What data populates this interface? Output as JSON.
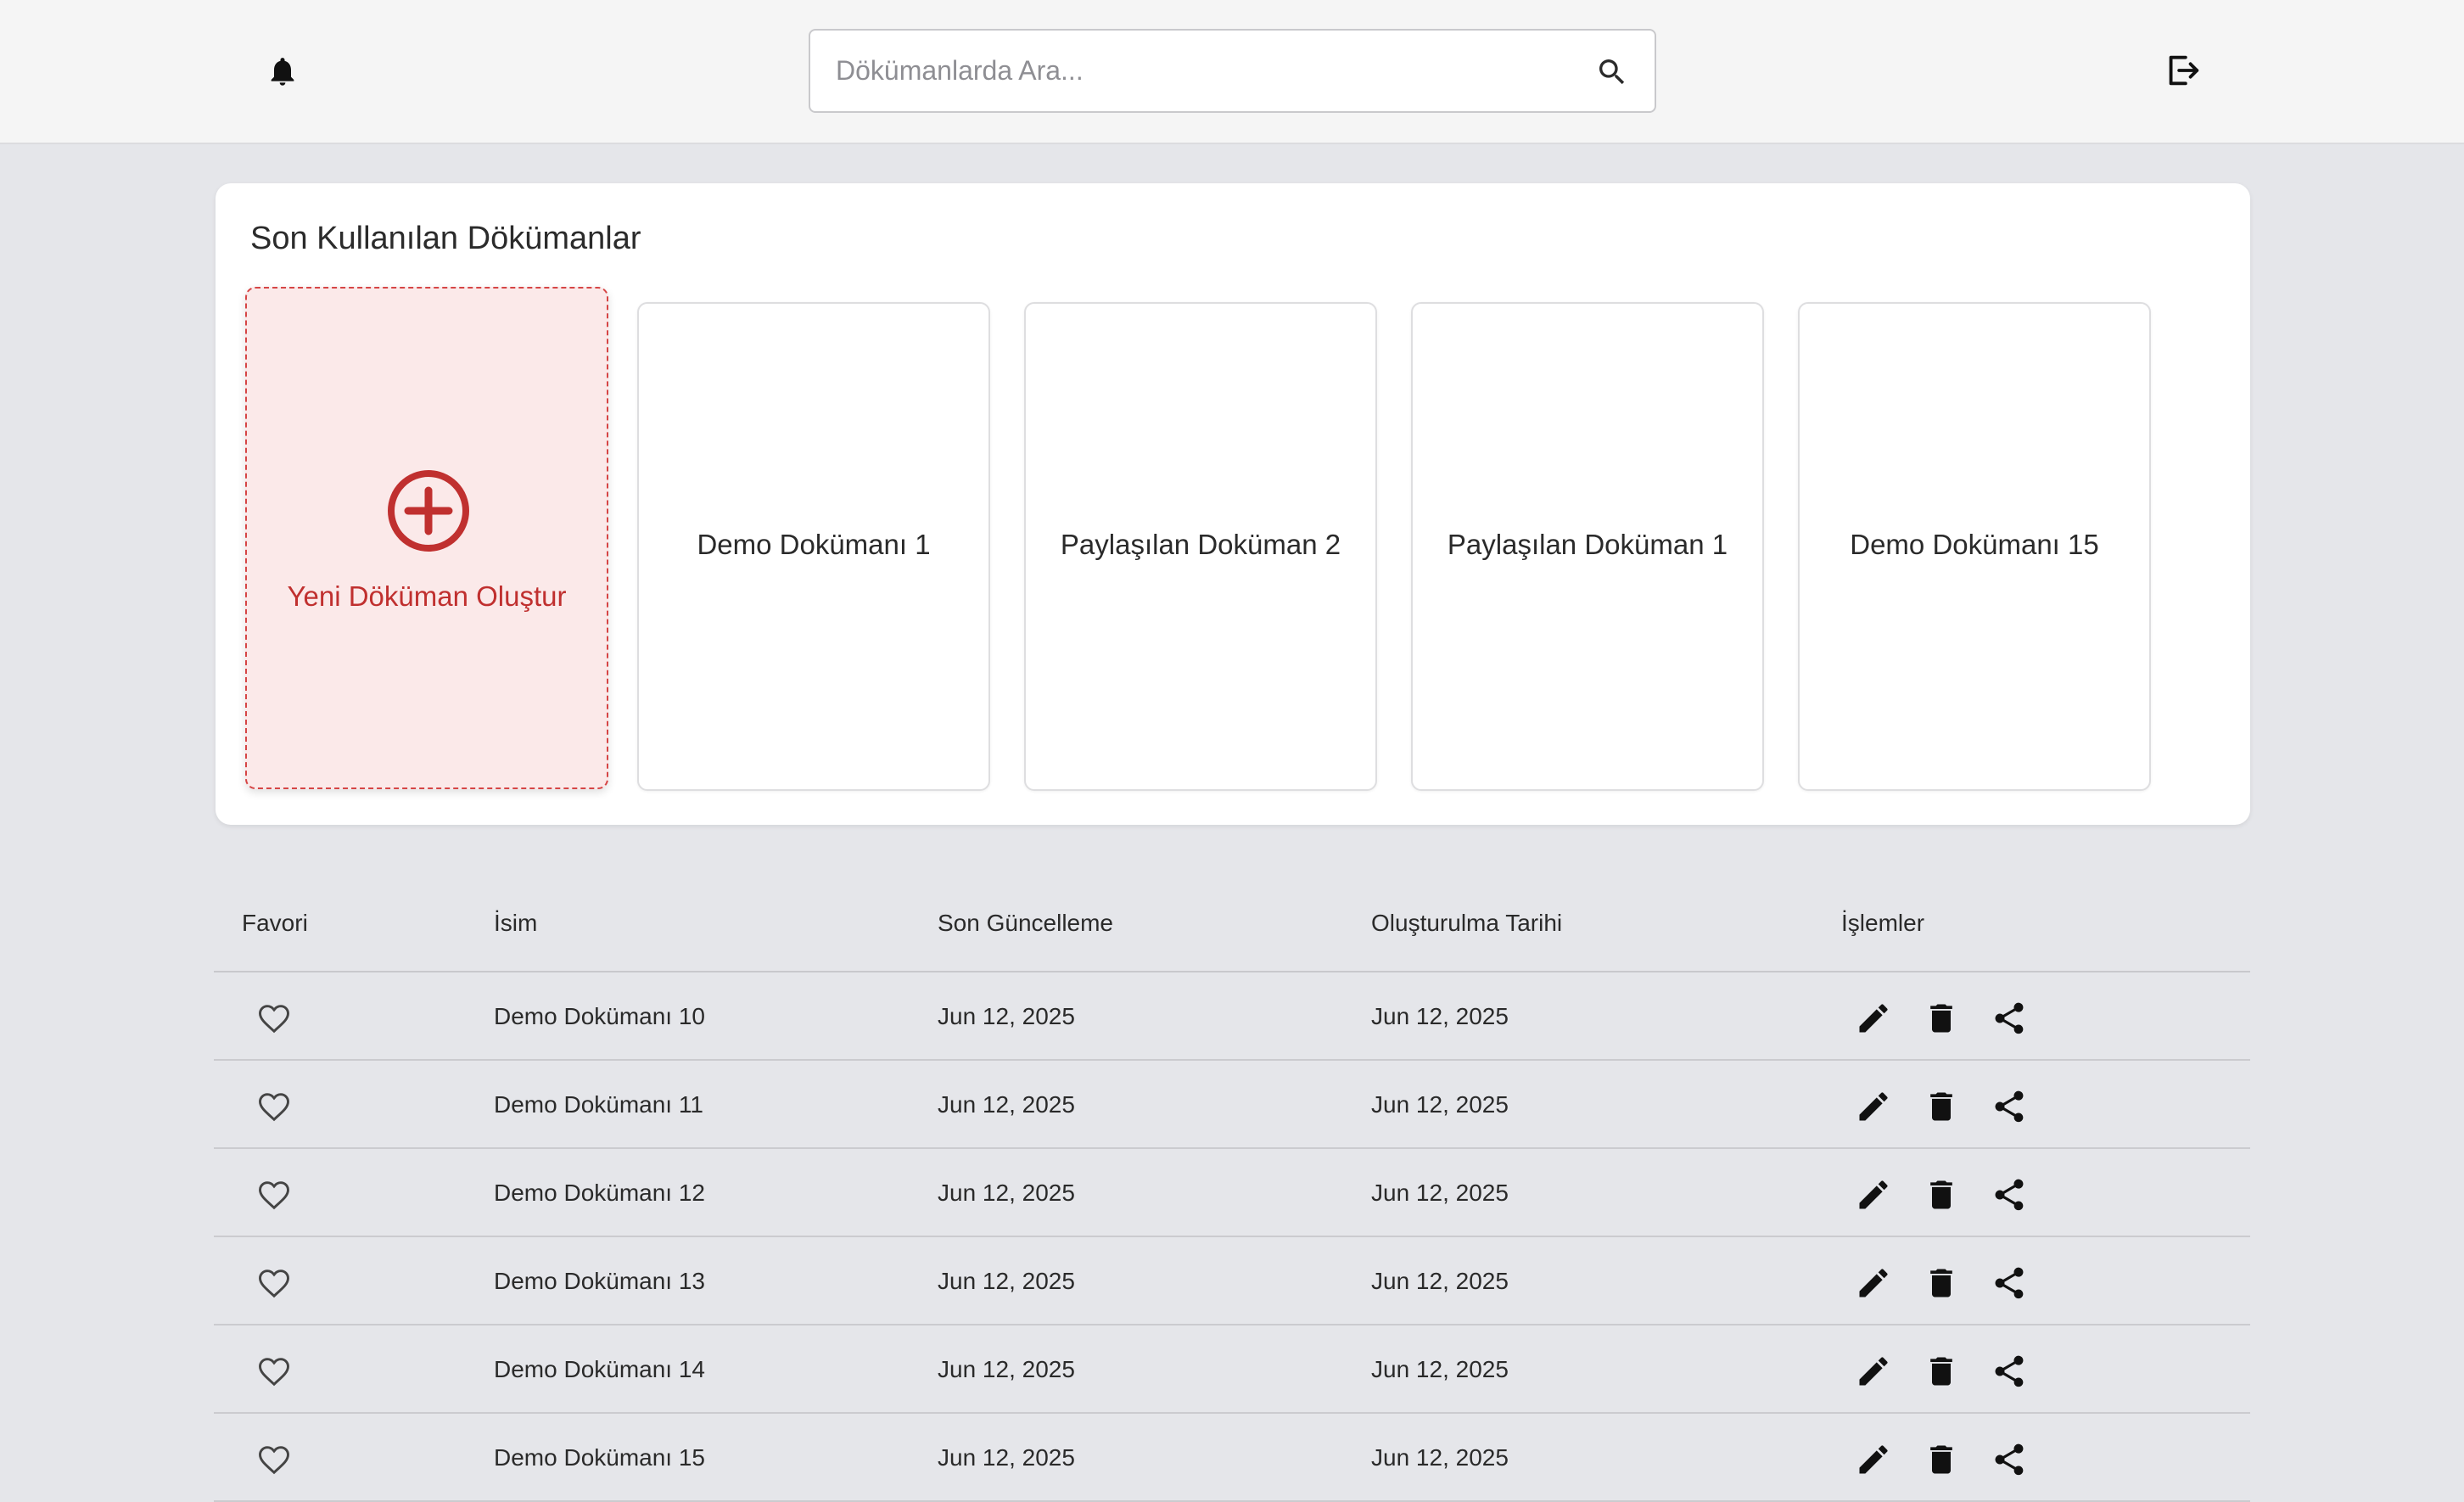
{
  "header": {
    "search_placeholder": "Dökümanlarda Ara...",
    "icons": [
      "bell-icon",
      "search-icon",
      "logout-icon"
    ]
  },
  "recent": {
    "title": "Son Kullanılan Dökümanlar",
    "new_doc_label": "Yeni Döküman Oluştur",
    "accent_color": "#c0302f",
    "cards": [
      {
        "label": "Demo Dokümanı 1"
      },
      {
        "label": "Paylaşılan Doküman 2"
      },
      {
        "label": "Paylaşılan Doküman 1"
      },
      {
        "label": "Demo Dokümanı 15"
      }
    ]
  },
  "table": {
    "headers": {
      "favorite": "Favori",
      "name": "İsim",
      "updated": "Son Güncelleme",
      "created": "Oluşturulma Tarihi",
      "actions": "İşlemler"
    },
    "rows": [
      {
        "name": "Demo Dokümanı 10",
        "updated": "Jun 12, 2025",
        "created": "Jun 12, 2025"
      },
      {
        "name": "Demo Dokümanı 11",
        "updated": "Jun 12, 2025",
        "created": "Jun 12, 2025"
      },
      {
        "name": "Demo Dokümanı 12",
        "updated": "Jun 12, 2025",
        "created": "Jun 12, 2025"
      },
      {
        "name": "Demo Dokümanı 13",
        "updated": "Jun 12, 2025",
        "created": "Jun 12, 2025"
      },
      {
        "name": "Demo Dokümanı 14",
        "updated": "Jun 12, 2025",
        "created": "Jun 12, 2025"
      },
      {
        "name": "Demo Dokümanı 15",
        "updated": "Jun 12, 2025",
        "created": "Jun 12, 2025"
      }
    ],
    "row_icons": [
      "heart-outline-icon",
      "pencil-icon",
      "trash-icon",
      "share-icon"
    ]
  }
}
